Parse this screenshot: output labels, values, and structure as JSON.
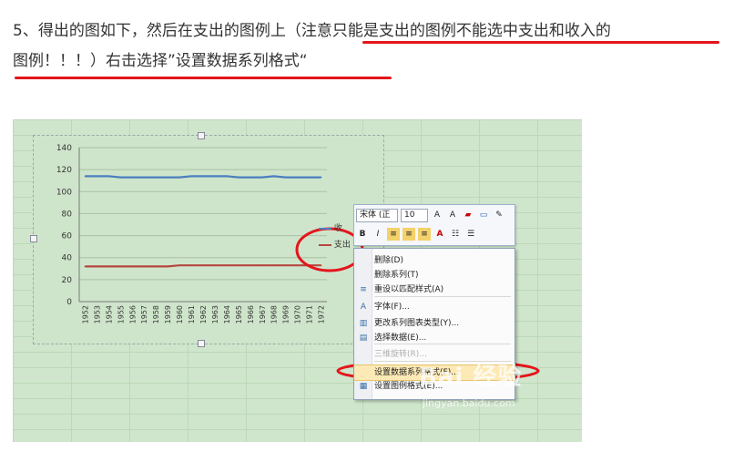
{
  "instruction": {
    "part1": "5、得出的图如下，然后在支出的图例上（",
    "part2": "注意只能是支出的图例不能选中支出和收入的",
    "part3": "图例！！！）",
    "part4": "右击选择”设置数据系列格式“"
  },
  "chart_data": {
    "type": "line",
    "categories": [
      "1952",
      "1953",
      "1954",
      "1955",
      "1956",
      "1957",
      "1958",
      "1959",
      "1960",
      "1961",
      "1962",
      "1963",
      "1964",
      "1965",
      "1966",
      "1967",
      "1968",
      "1969",
      "1970",
      "1971",
      "1972"
    ],
    "series": [
      {
        "name": "收",
        "color": "#4a7fbf",
        "values": [
          114,
          114,
          114,
          113,
          113,
          113,
          113,
          113,
          113,
          114,
          114,
          114,
          114,
          113,
          113,
          113,
          114,
          113,
          113,
          113,
          113
        ]
      },
      {
        "name": "支出",
        "color": "#b5473f",
        "values": [
          32,
          32,
          32,
          32,
          32,
          32,
          32,
          32,
          33,
          33,
          33,
          33,
          33,
          33,
          33,
          33,
          33,
          33,
          33,
          33,
          33
        ]
      }
    ],
    "ylim": [
      0,
      140
    ],
    "yticks": [
      0,
      20,
      40,
      60,
      80,
      100,
      120,
      140
    ],
    "grid": true
  },
  "toolbar": {
    "font": "宋体 (正",
    "size": "10",
    "grow": "A",
    "shrink": "A",
    "bold": "B",
    "italic": "I"
  },
  "context_menu": {
    "items": [
      {
        "label": "删除(D)",
        "icon": "",
        "disabled": false
      },
      {
        "label": "删除系列(T)",
        "icon": "",
        "disabled": false
      },
      {
        "label": "重设以匹配样式(A)",
        "icon": "≡",
        "disabled": false
      },
      {
        "label": "字体(F)...",
        "icon": "A",
        "disabled": false
      },
      {
        "label": "更改系列图表类型(Y)...",
        "icon": "▥",
        "disabled": false
      },
      {
        "label": "选择数据(E)...",
        "icon": "▤",
        "disabled": false
      },
      {
        "label": "三维旋转(R)...",
        "icon": "",
        "disabled": true
      },
      {
        "label": "设置数据系列格式(F)...",
        "icon": "",
        "disabled": false,
        "active": true
      },
      {
        "label": "设置图例格式(E)...",
        "icon": "▦",
        "disabled": false
      }
    ]
  },
  "watermark": {
    "brand": "Bai 经验",
    "url": "jingyan.baidu.com"
  },
  "colors": {
    "annotation_red": "#e3161c",
    "chart_bg": "#cfe5cb"
  }
}
